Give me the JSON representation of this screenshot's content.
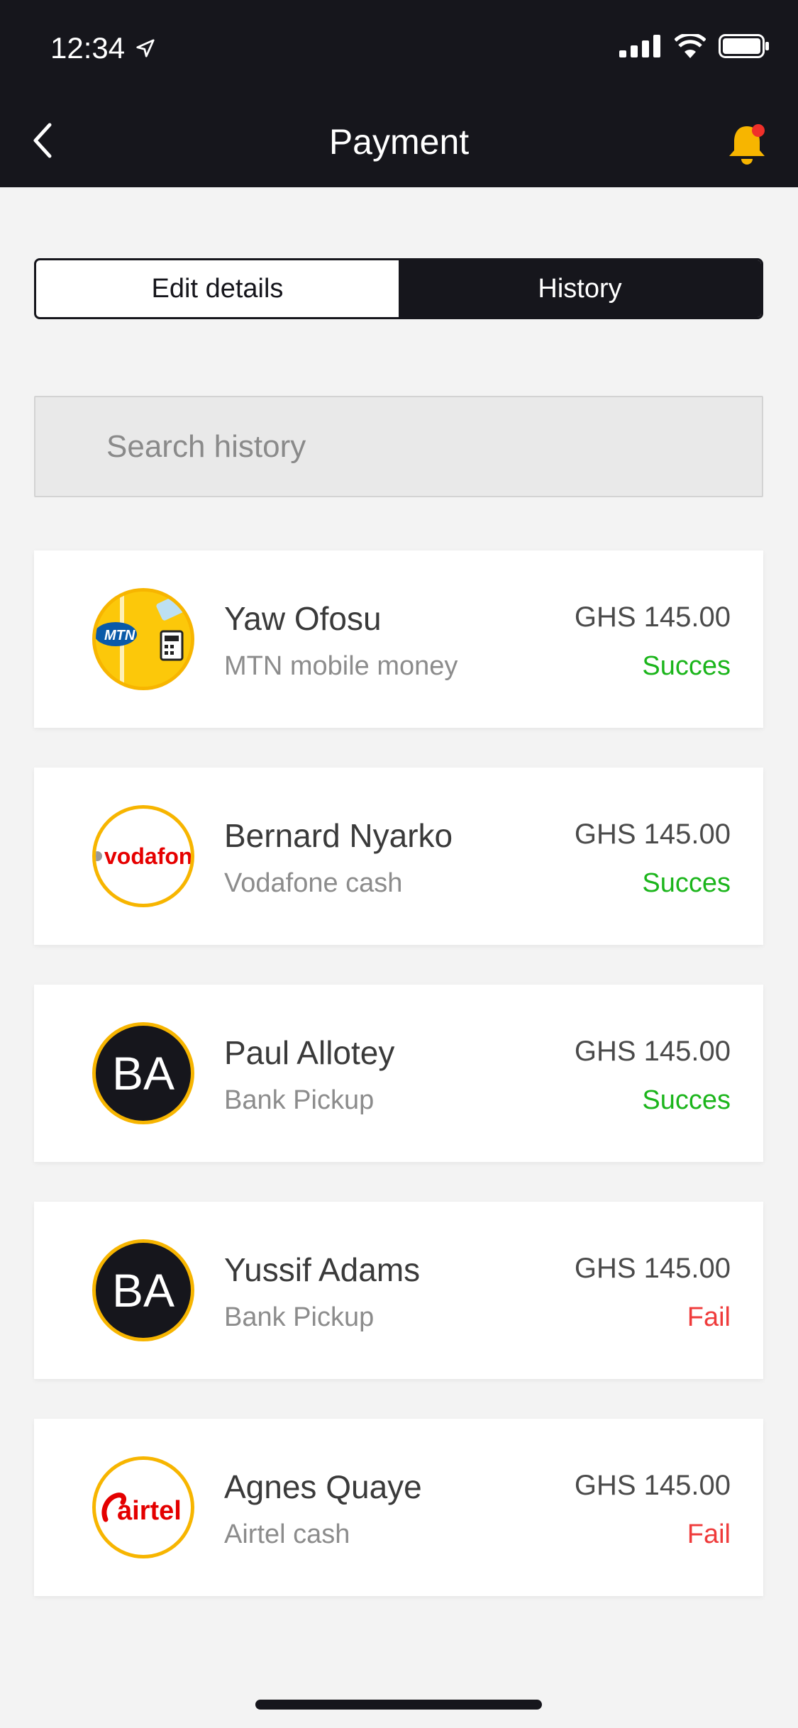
{
  "status_bar": {
    "time": "12:34"
  },
  "header": {
    "title": "Payment"
  },
  "tabs": [
    {
      "label": "Edit details",
      "active": false
    },
    {
      "label": "History",
      "active": true
    }
  ],
  "search": {
    "placeholder": "Search history",
    "value": ""
  },
  "transactions": [
    {
      "name": "Yaw Ofosu",
      "method": "MTN mobile money",
      "amount": "GHS 145.00",
      "status": "Succes",
      "status_type": "success",
      "avatar": "mtn-logo",
      "avatar_text": "MTN"
    },
    {
      "name": "Bernard Nyarko",
      "method": "Vodafone cash",
      "amount": "GHS 145.00",
      "status": "Succes",
      "status_type": "success",
      "avatar": "vodafone-logo",
      "avatar_text": "vodafone"
    },
    {
      "name": "Paul Allotey",
      "method": "Bank Pickup",
      "amount": "GHS 145.00",
      "status": "Succes",
      "status_type": "success",
      "avatar": "initials",
      "avatar_text": "BA"
    },
    {
      "name": "Yussif Adams",
      "method": "Bank Pickup",
      "amount": "GHS 145.00",
      "status": "Fail",
      "status_type": "fail",
      "avatar": "initials",
      "avatar_text": "BA"
    },
    {
      "name": "Agnes Quaye",
      "method": "Airtel cash",
      "amount": "GHS 145.00",
      "status": "Fail",
      "status_type": "fail",
      "avatar": "airtel-logo",
      "avatar_text": "airtel"
    }
  ],
  "colors": {
    "header_bg": "#16161c",
    "accent": "#f7b500",
    "success": "#1bb51b",
    "fail": "#ef3b3b",
    "notification_dot": "#f0302a"
  }
}
